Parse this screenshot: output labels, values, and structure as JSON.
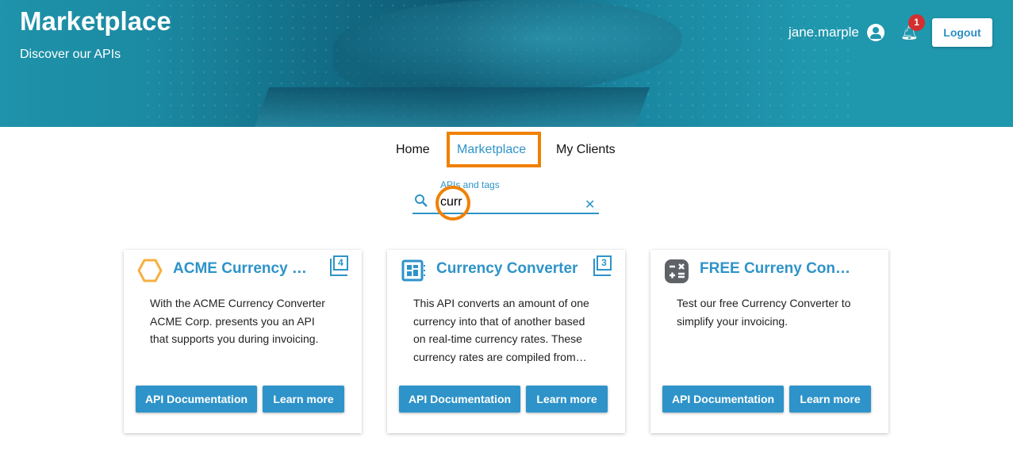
{
  "header": {
    "title": "Marketplace",
    "subtitle": "Discover our APIs",
    "username": "jane.marple",
    "notification_count": "1",
    "logout_label": "Logout"
  },
  "nav": {
    "items": [
      {
        "label": "Home"
      },
      {
        "label": "Marketplace",
        "active": true
      },
      {
        "label": "My Clients"
      }
    ]
  },
  "search": {
    "label": "APIs and tags",
    "value": "curr"
  },
  "colors": {
    "accent": "#2e93c9",
    "highlight": "#f08000",
    "header": "#1f97ad"
  },
  "cards": [
    {
      "name": "ACME Currency Converter",
      "count": "4",
      "icon": "hexagon-logo-icon",
      "description": "With the ACME Currency Converter ACME Corp. presents you an API that supports you during invoicing.",
      "doc_label": "API Documentation",
      "learn_label": "Learn more"
    },
    {
      "name": "Currency Converter",
      "count": "3",
      "icon": "dashboard-icon",
      "description": "This API converts an amount of one currency into that of another based on real-time currency rates. These currency rates are compiled from…",
      "doc_label": "API Documentation",
      "learn_label": "Learn more"
    },
    {
      "name": "FREE Curreny Converter",
      "count": "",
      "icon": "calculator-icon",
      "description": "Test our free Currency Converter to simplify your invoicing.",
      "doc_label": "API Documentation",
      "learn_label": "Learn more"
    }
  ]
}
